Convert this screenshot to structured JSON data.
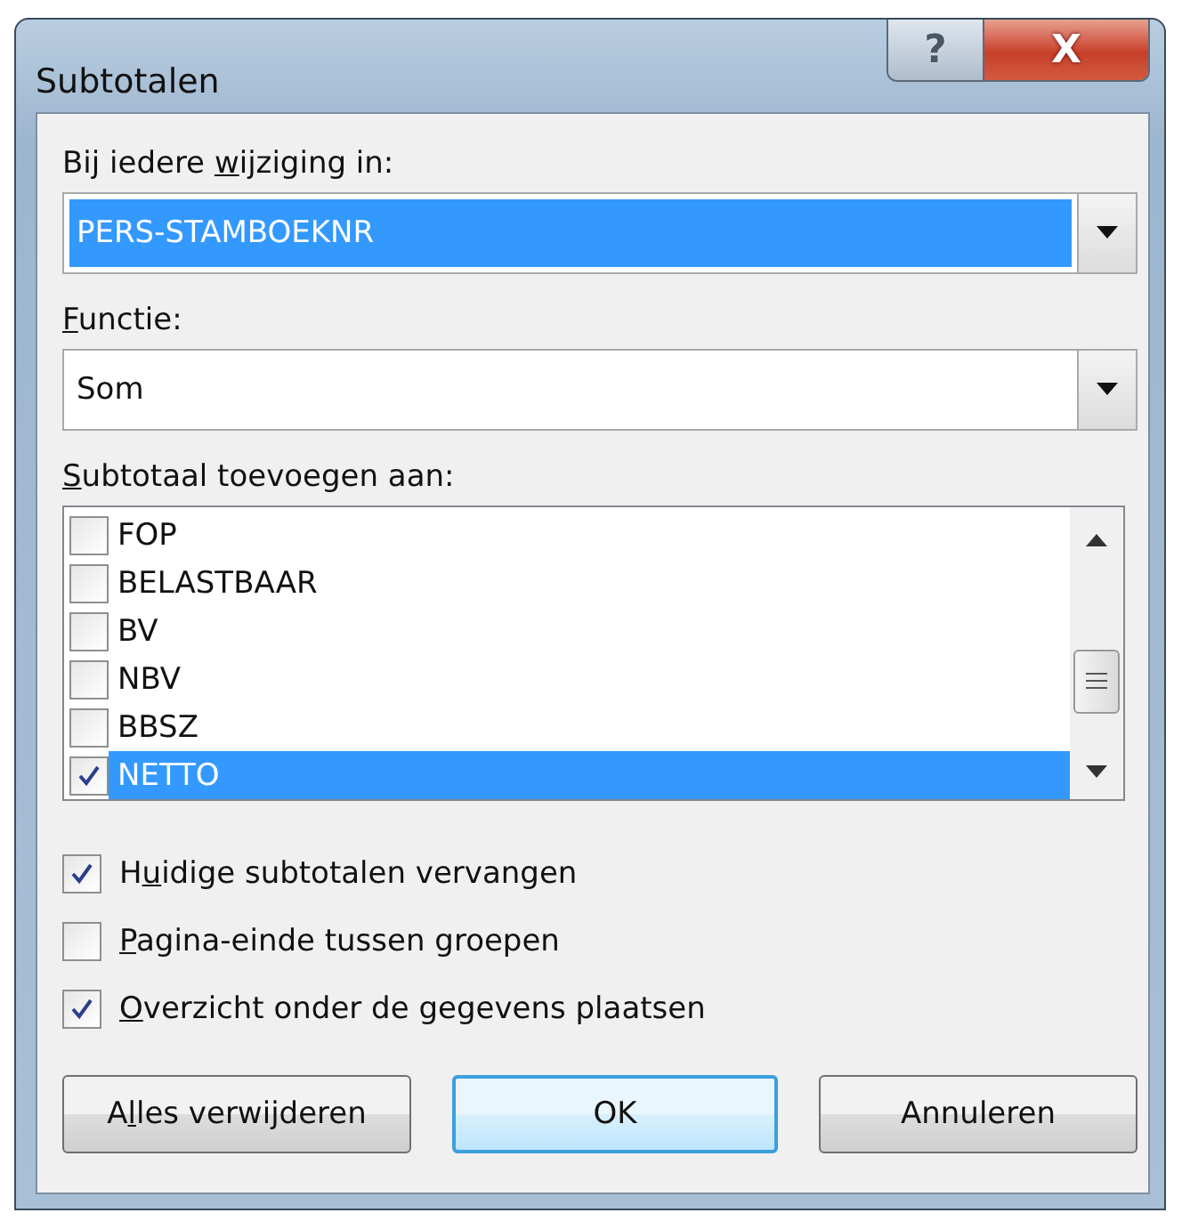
{
  "window": {
    "title": "Subtotalen",
    "help_button": "?",
    "close_button": "X"
  },
  "change_field": {
    "label": {
      "pre": "Bij iedere ",
      "key": "w",
      "post": "ijziging in:"
    },
    "value": "PERS-STAMBOEKNR",
    "highlighted": true
  },
  "function_field": {
    "label": {
      "key": "F",
      "post": "unctie:"
    },
    "value": "Som",
    "highlighted": false
  },
  "add_to": {
    "label": {
      "key": "S",
      "post": "ubtotaal toevoegen aan:"
    },
    "items": [
      {
        "label": "FOP",
        "checked": false,
        "selected": false
      },
      {
        "label": "BELASTBAAR",
        "checked": false,
        "selected": false
      },
      {
        "label": "BV",
        "checked": false,
        "selected": false
      },
      {
        "label": "NBV",
        "checked": false,
        "selected": false
      },
      {
        "label": "BBSZ",
        "checked": false,
        "selected": false
      },
      {
        "label": "NETTO",
        "checked": true,
        "selected": true
      }
    ]
  },
  "options": [
    {
      "label": {
        "pre": "H",
        "key": "u",
        "post": "idige subtotalen vervangen"
      },
      "checked": true
    },
    {
      "label": {
        "key": "P",
        "post": "agina-einde tussen groepen"
      },
      "checked": false
    },
    {
      "label": {
        "key": "O",
        "post": "verzicht onder de gegevens plaatsen"
      },
      "checked": true
    }
  ],
  "buttons": [
    {
      "label": {
        "pre": "A",
        "key": "l",
        "post": "les verwijderen"
      },
      "default": false
    },
    {
      "label": {
        "post": "OK"
      },
      "default": true
    },
    {
      "label": {
        "post": "Annuleren"
      },
      "default": false
    }
  ]
}
